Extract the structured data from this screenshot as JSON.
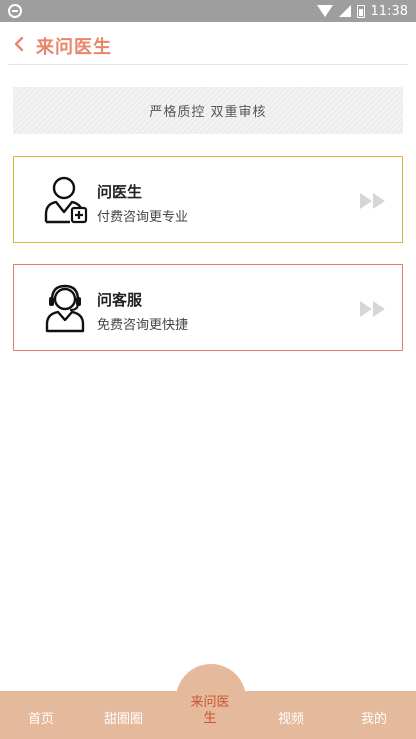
{
  "status_bar": {
    "time": "11:38",
    "icons": [
      "sync-icon",
      "wifi-icon",
      "signal-icon",
      "battery-icon"
    ]
  },
  "header": {
    "back_icon": "chevron-left-icon",
    "title": "来问医生"
  },
  "banner": {
    "text": "严格质控  双重审核"
  },
  "cards": [
    {
      "id": "doctor",
      "name": "问医生",
      "desc": "付费咨询更专业",
      "icon": "doctor-icon",
      "arrow_icon": "double-play-icon",
      "border_color": "#e3b23c"
    },
    {
      "id": "service",
      "name": "问客服",
      "desc": "免费咨询更快捷",
      "icon": "customer-service-icon",
      "arrow_icon": "double-play-icon",
      "border_color": "#e87b6a"
    }
  ],
  "tabbar": {
    "bg_color": "#e5b99b",
    "items": [
      {
        "label": "首页",
        "active": false
      },
      {
        "label": "甜圈圈",
        "active": false
      },
      {
        "label": "来问医生",
        "active": true
      },
      {
        "label": "视频",
        "active": false
      },
      {
        "label": "我的",
        "active": false
      }
    ]
  },
  "colors": {
    "accent": "#e8856a",
    "active_tab_text": "#c8572f"
  }
}
